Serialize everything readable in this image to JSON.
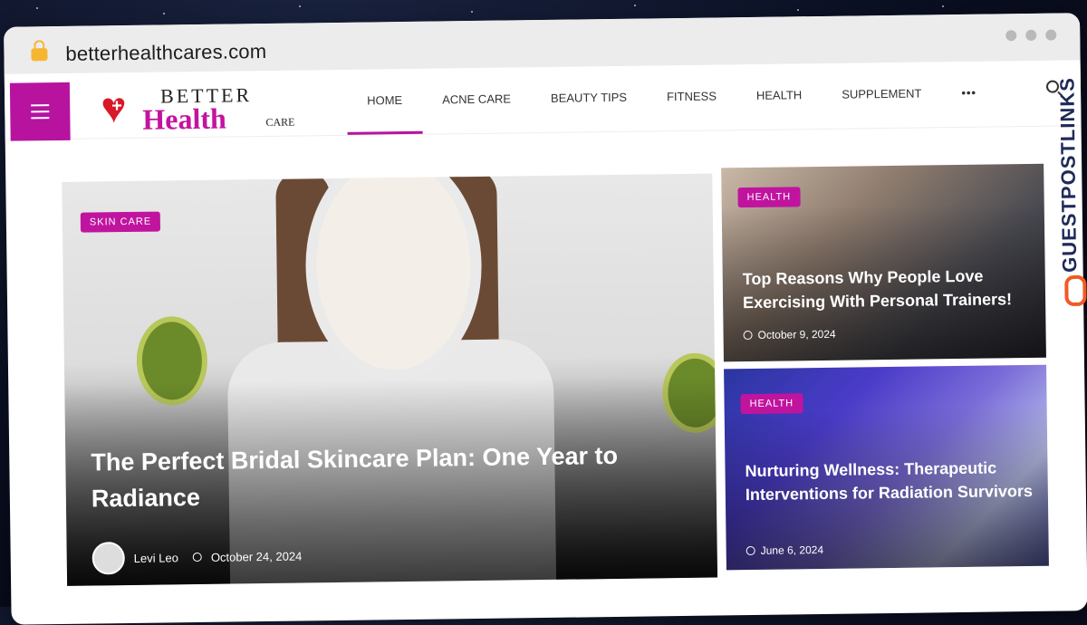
{
  "browser": {
    "url": "betterhealthcares.com"
  },
  "site": {
    "logo": {
      "better": "BETTER",
      "health": "Health",
      "care": "CARE"
    },
    "menu": [
      {
        "label": "HOME",
        "active": true
      },
      {
        "label": "ACNE CARE",
        "active": false
      },
      {
        "label": "BEAUTY TIPS",
        "active": false
      },
      {
        "label": "FITNESS",
        "active": false
      },
      {
        "label": "HEALTH",
        "active": false
      },
      {
        "label": "SUPPLEMENT",
        "active": false
      }
    ],
    "more_label": "•••",
    "accent_color": "#c0149f"
  },
  "hero": {
    "category": "SKIN CARE",
    "title": "The Perfect Bridal Skincare Plan: One Year to Radiance",
    "author": "Levi Leo",
    "date": "October 24, 2024"
  },
  "side_cards": [
    {
      "category": "HEALTH",
      "title": "Top Reasons Why People Love Exercising With Personal Trainers!",
      "date": "October 9, 2024"
    },
    {
      "category": "HEALTH",
      "title": "Nurturing Wellness: Therapeutic Interventions for Radiation Survivors",
      "date": "June 6, 2024"
    }
  ],
  "watermark": {
    "brand": "GUESTPOSTLINKS"
  }
}
